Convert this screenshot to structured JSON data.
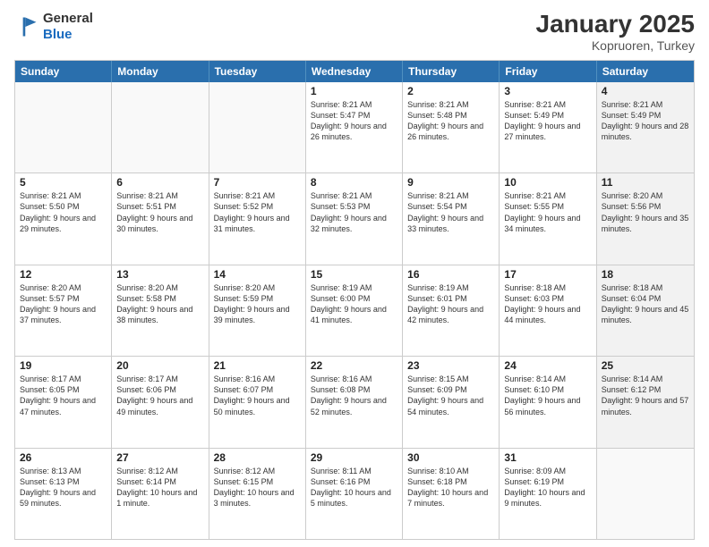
{
  "logo": {
    "general": "General",
    "blue": "Blue"
  },
  "header": {
    "month": "January 2025",
    "location": "Kopruoren, Turkey"
  },
  "dayHeaders": [
    "Sunday",
    "Monday",
    "Tuesday",
    "Wednesday",
    "Thursday",
    "Friday",
    "Saturday"
  ],
  "weeks": [
    [
      {
        "day": "",
        "info": "",
        "empty": true
      },
      {
        "day": "",
        "info": "",
        "empty": true
      },
      {
        "day": "",
        "info": "",
        "empty": true
      },
      {
        "day": "1",
        "info": "Sunrise: 8:21 AM\nSunset: 5:47 PM\nDaylight: 9 hours and 26 minutes."
      },
      {
        "day": "2",
        "info": "Sunrise: 8:21 AM\nSunset: 5:48 PM\nDaylight: 9 hours and 26 minutes."
      },
      {
        "day": "3",
        "info": "Sunrise: 8:21 AM\nSunset: 5:49 PM\nDaylight: 9 hours and 27 minutes."
      },
      {
        "day": "4",
        "info": "Sunrise: 8:21 AM\nSunset: 5:49 PM\nDaylight: 9 hours and 28 minutes.",
        "shaded": true
      }
    ],
    [
      {
        "day": "5",
        "info": "Sunrise: 8:21 AM\nSunset: 5:50 PM\nDaylight: 9 hours and 29 minutes."
      },
      {
        "day": "6",
        "info": "Sunrise: 8:21 AM\nSunset: 5:51 PM\nDaylight: 9 hours and 30 minutes."
      },
      {
        "day": "7",
        "info": "Sunrise: 8:21 AM\nSunset: 5:52 PM\nDaylight: 9 hours and 31 minutes."
      },
      {
        "day": "8",
        "info": "Sunrise: 8:21 AM\nSunset: 5:53 PM\nDaylight: 9 hours and 32 minutes."
      },
      {
        "day": "9",
        "info": "Sunrise: 8:21 AM\nSunset: 5:54 PM\nDaylight: 9 hours and 33 minutes."
      },
      {
        "day": "10",
        "info": "Sunrise: 8:21 AM\nSunset: 5:55 PM\nDaylight: 9 hours and 34 minutes."
      },
      {
        "day": "11",
        "info": "Sunrise: 8:20 AM\nSunset: 5:56 PM\nDaylight: 9 hours and 35 minutes.",
        "shaded": true
      }
    ],
    [
      {
        "day": "12",
        "info": "Sunrise: 8:20 AM\nSunset: 5:57 PM\nDaylight: 9 hours and 37 minutes."
      },
      {
        "day": "13",
        "info": "Sunrise: 8:20 AM\nSunset: 5:58 PM\nDaylight: 9 hours and 38 minutes."
      },
      {
        "day": "14",
        "info": "Sunrise: 8:20 AM\nSunset: 5:59 PM\nDaylight: 9 hours and 39 minutes."
      },
      {
        "day": "15",
        "info": "Sunrise: 8:19 AM\nSunset: 6:00 PM\nDaylight: 9 hours and 41 minutes."
      },
      {
        "day": "16",
        "info": "Sunrise: 8:19 AM\nSunset: 6:01 PM\nDaylight: 9 hours and 42 minutes."
      },
      {
        "day": "17",
        "info": "Sunrise: 8:18 AM\nSunset: 6:03 PM\nDaylight: 9 hours and 44 minutes."
      },
      {
        "day": "18",
        "info": "Sunrise: 8:18 AM\nSunset: 6:04 PM\nDaylight: 9 hours and 45 minutes.",
        "shaded": true
      }
    ],
    [
      {
        "day": "19",
        "info": "Sunrise: 8:17 AM\nSunset: 6:05 PM\nDaylight: 9 hours and 47 minutes."
      },
      {
        "day": "20",
        "info": "Sunrise: 8:17 AM\nSunset: 6:06 PM\nDaylight: 9 hours and 49 minutes."
      },
      {
        "day": "21",
        "info": "Sunrise: 8:16 AM\nSunset: 6:07 PM\nDaylight: 9 hours and 50 minutes."
      },
      {
        "day": "22",
        "info": "Sunrise: 8:16 AM\nSunset: 6:08 PM\nDaylight: 9 hours and 52 minutes."
      },
      {
        "day": "23",
        "info": "Sunrise: 8:15 AM\nSunset: 6:09 PM\nDaylight: 9 hours and 54 minutes."
      },
      {
        "day": "24",
        "info": "Sunrise: 8:14 AM\nSunset: 6:10 PM\nDaylight: 9 hours and 56 minutes."
      },
      {
        "day": "25",
        "info": "Sunrise: 8:14 AM\nSunset: 6:12 PM\nDaylight: 9 hours and 57 minutes.",
        "shaded": true
      }
    ],
    [
      {
        "day": "26",
        "info": "Sunrise: 8:13 AM\nSunset: 6:13 PM\nDaylight: 9 hours and 59 minutes."
      },
      {
        "day": "27",
        "info": "Sunrise: 8:12 AM\nSunset: 6:14 PM\nDaylight: 10 hours and 1 minute."
      },
      {
        "day": "28",
        "info": "Sunrise: 8:12 AM\nSunset: 6:15 PM\nDaylight: 10 hours and 3 minutes."
      },
      {
        "day": "29",
        "info": "Sunrise: 8:11 AM\nSunset: 6:16 PM\nDaylight: 10 hours and 5 minutes."
      },
      {
        "day": "30",
        "info": "Sunrise: 8:10 AM\nSunset: 6:18 PM\nDaylight: 10 hours and 7 minutes."
      },
      {
        "day": "31",
        "info": "Sunrise: 8:09 AM\nSunset: 6:19 PM\nDaylight: 10 hours and 9 minutes."
      },
      {
        "day": "",
        "info": "",
        "empty": true,
        "shaded": true
      }
    ]
  ]
}
